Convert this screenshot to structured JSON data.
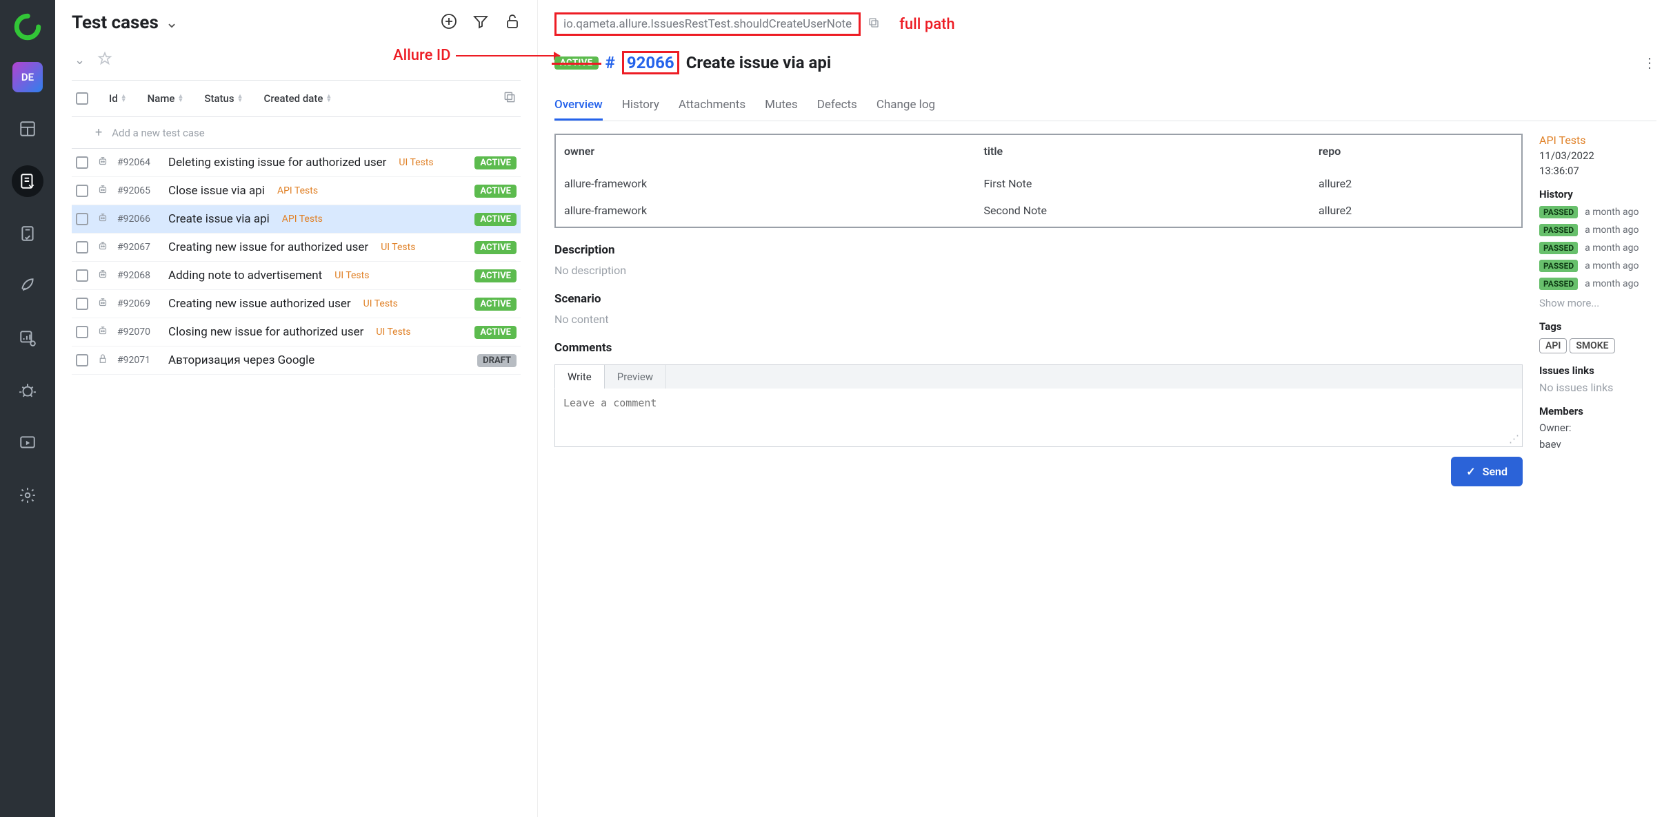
{
  "sidebar": {
    "avatar": "DE"
  },
  "leftpanel": {
    "title": "Test cases",
    "columns": {
      "id": "Id",
      "name": "Name",
      "status": "Status",
      "created": "Created date"
    },
    "new_placeholder": "Add a new test case",
    "rows": [
      {
        "id": "#92064",
        "name": "Deleting existing issue for authorized user",
        "suite": "UI Tests",
        "status": "ACTIVE",
        "auto": true
      },
      {
        "id": "#92065",
        "name": "Close issue via api",
        "suite": "API Tests",
        "status": "ACTIVE",
        "auto": true
      },
      {
        "id": "#92066",
        "name": "Create issue via api",
        "suite": "API Tests",
        "status": "ACTIVE",
        "auto": true,
        "selected": true
      },
      {
        "id": "#92067",
        "name": "Creating new issue for authorized user",
        "suite": "UI Tests",
        "status": "ACTIVE",
        "auto": true
      },
      {
        "id": "#92068",
        "name": "Adding note to advertisement",
        "suite": "UI Tests",
        "status": "ACTIVE",
        "auto": true
      },
      {
        "id": "#92069",
        "name": "Creating new issue authorized user",
        "suite": "UI Tests",
        "status": "ACTIVE",
        "auto": true
      },
      {
        "id": "#92070",
        "name": "Closing new issue for authorized user",
        "suite": "UI Tests",
        "status": "ACTIVE",
        "auto": true
      },
      {
        "id": "#92071",
        "name": "Авторизация через Google",
        "suite": "",
        "status": "DRAFT",
        "auto": false
      }
    ]
  },
  "rightpanel": {
    "annotations": {
      "allure_id": "Allure ID",
      "full_path": "full path"
    },
    "full_path": "io.qameta.allure.IssuesRestTest.shouldCreateUserNote",
    "status": "ACTIVE",
    "hash": "#",
    "id": "92066",
    "title": "Create issue via api",
    "tabs": [
      {
        "label": "Overview",
        "active": true
      },
      {
        "label": "History"
      },
      {
        "label": "Attachments"
      },
      {
        "label": "Mutes"
      },
      {
        "label": "Defects"
      },
      {
        "label": "Change log"
      }
    ],
    "params": {
      "headers": {
        "owner": "owner",
        "title": "title",
        "repo": "repo"
      },
      "rows": [
        {
          "owner": "allure-framework",
          "title": "First Note",
          "repo": "allure2"
        },
        {
          "owner": "allure-framework",
          "title": "Second Note",
          "repo": "allure2"
        }
      ]
    },
    "sections": {
      "description_h": "Description",
      "description_v": "No description",
      "scenario_h": "Scenario",
      "scenario_v": "No content",
      "comments_h": "Comments",
      "write": "Write",
      "preview": "Preview",
      "comment_ph": "Leave a comment",
      "send": "Send"
    },
    "meta": {
      "suite": "API Tests",
      "date": "11/03/2022",
      "time": "13:36:07",
      "history_h": "History",
      "history": [
        {
          "status": "PASSED",
          "when": "a month ago"
        },
        {
          "status": "PASSED",
          "when": "a month ago"
        },
        {
          "status": "PASSED",
          "when": "a month ago"
        },
        {
          "status": "PASSED",
          "when": "a month ago"
        },
        {
          "status": "PASSED",
          "when": "a month ago"
        }
      ],
      "show_more": "Show more...",
      "tags_h": "Tags",
      "tags": [
        "API",
        "SMOKE"
      ],
      "issues_h": "Issues links",
      "issues_v": "No issues links",
      "members_h": "Members",
      "owner_l": "Owner:",
      "owner_v": "baev"
    }
  }
}
